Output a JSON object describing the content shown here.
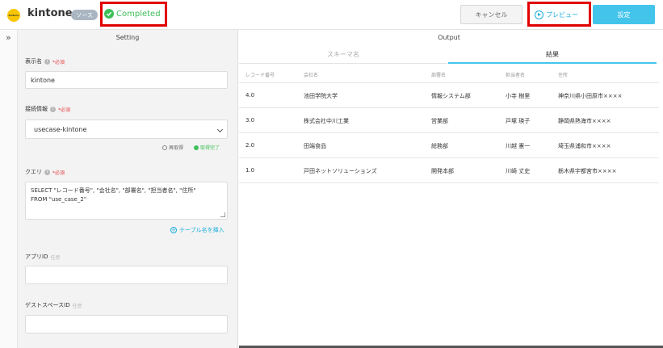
{
  "header": {
    "logo_text": "kintone",
    "app_title": "kintone",
    "source_badge": "ソース",
    "status": "Completed",
    "cancel_label": "キャンセル",
    "preview_label": "プレビュー",
    "settings_label": "設定"
  },
  "colors": {
    "accent": "#43c5eb",
    "success": "#3ec15a",
    "highlight": "#e00000",
    "required": "#e64545"
  },
  "settings": {
    "title": "Setting",
    "display_name": {
      "label": "表示名",
      "required": "*必須",
      "value": "kintone"
    },
    "connection": {
      "label": "接続情報",
      "required": "*必須",
      "value": "usecase-kintone",
      "refresh": "再取得",
      "fetched": "取得完了"
    },
    "query": {
      "label": "クエリ",
      "required": "*必須",
      "line1": "SELECT \"レコード番号\", \"会社名\", \"部署名\", \"担当者名\", \"住所\"",
      "line2": "FROM  \"use_case_2\"",
      "insert_table": "テーブル名を挿入"
    },
    "app_id": {
      "label": "アプリID",
      "optional": "任意",
      "value": ""
    },
    "guest_space_id": {
      "label": "ゲストスペースID",
      "optional": "任意",
      "value": ""
    }
  },
  "output": {
    "title": "Output",
    "tabs": [
      "スキーマ名",
      "結果"
    ],
    "columns": [
      "レコード番号",
      "会社名",
      "部署名",
      "担当者名",
      "住所"
    ],
    "rows": [
      [
        "4.0",
        "池田学院大学",
        "情報システム部",
        "小寺 樹里",
        "神奈川県小田原市××××"
      ],
      [
        "3.0",
        "株式会社中川工業",
        "営業部",
        "戸塚 瑛子",
        "静岡県熱海市××××"
      ],
      [
        "2.0",
        "田端食品",
        "総務部",
        "川越 憲一",
        "埼玉県浦和市××××"
      ],
      [
        "1.0",
        "戸田ネットソリューションズ",
        "開発本部",
        "川崎 丈史",
        "栃木県宇都宮市××××"
      ]
    ]
  }
}
